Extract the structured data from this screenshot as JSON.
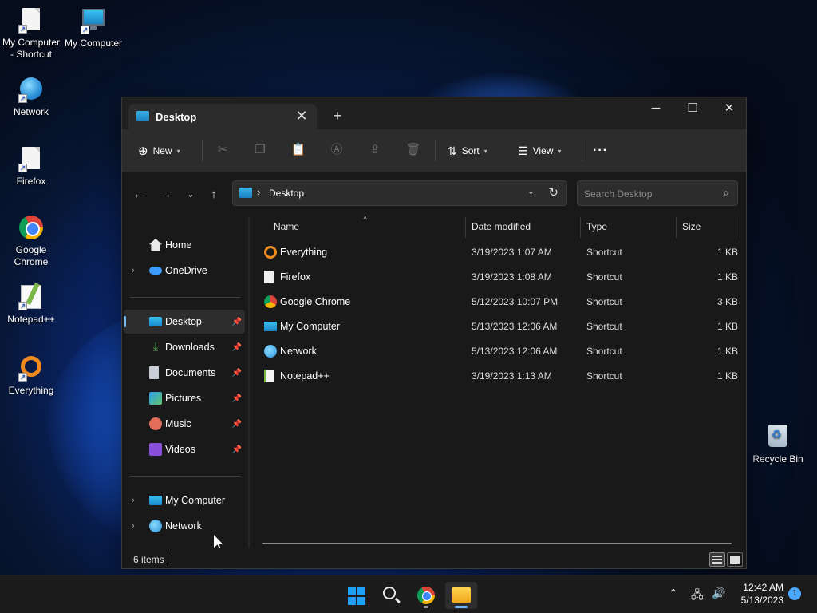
{
  "desktop": {
    "icons": [
      {
        "label": "My Computer - Shortcut",
        "icon": "document-shortcut-icon"
      },
      {
        "label": "My Computer",
        "icon": "computer-icon"
      },
      {
        "label": "Network",
        "icon": "network-icon"
      },
      {
        "label": "Firefox",
        "icon": "document-shortcut-icon"
      },
      {
        "label": "Google Chrome",
        "icon": "chrome-icon"
      },
      {
        "label": "Notepad++",
        "icon": "notepad-icon"
      },
      {
        "label": "Everything",
        "icon": "everything-icon"
      },
      {
        "label": "Recycle Bin",
        "icon": "recycle-bin-icon"
      }
    ]
  },
  "window": {
    "tab_title": "Desktop",
    "new_tab_glyph": "+",
    "controls": {
      "minimize": "─",
      "maximize": "☐",
      "close": "✕"
    }
  },
  "toolbar": {
    "new_label": "New",
    "sort_label": "Sort",
    "view_label": "View",
    "more_glyph": "···"
  },
  "nav": {
    "breadcrumb": "Desktop",
    "search_placeholder": "Search Desktop"
  },
  "sidebar": {
    "home": "Home",
    "onedrive": "OneDrive",
    "desktop": "Desktop",
    "downloads": "Downloads",
    "documents": "Documents",
    "pictures": "Pictures",
    "music": "Music",
    "videos": "Videos",
    "my_computer": "My Computer",
    "network": "Network"
  },
  "columns": {
    "name": "Name",
    "date": "Date modified",
    "type": "Type",
    "size": "Size"
  },
  "files": [
    {
      "name": "Everything",
      "date": "3/19/2023 1:07 AM",
      "type": "Shortcut",
      "size": "1 KB"
    },
    {
      "name": "Firefox",
      "date": "3/19/2023 1:08 AM",
      "type": "Shortcut",
      "size": "1 KB"
    },
    {
      "name": "Google Chrome",
      "date": "5/12/2023 10:07 PM",
      "type": "Shortcut",
      "size": "3 KB"
    },
    {
      "name": "My Computer",
      "date": "5/13/2023 12:06 AM",
      "type": "Shortcut",
      "size": "1 KB"
    },
    {
      "name": "Network",
      "date": "5/13/2023 12:06 AM",
      "type": "Shortcut",
      "size": "1 KB"
    },
    {
      "name": "Notepad++",
      "date": "3/19/2023 1:13 AM",
      "type": "Shortcut",
      "size": "1 KB"
    }
  ],
  "status": {
    "item_count": "6 items"
  },
  "taskbar": {
    "time": "12:42 AM",
    "date": "5/13/2023",
    "notification_count": "1"
  }
}
